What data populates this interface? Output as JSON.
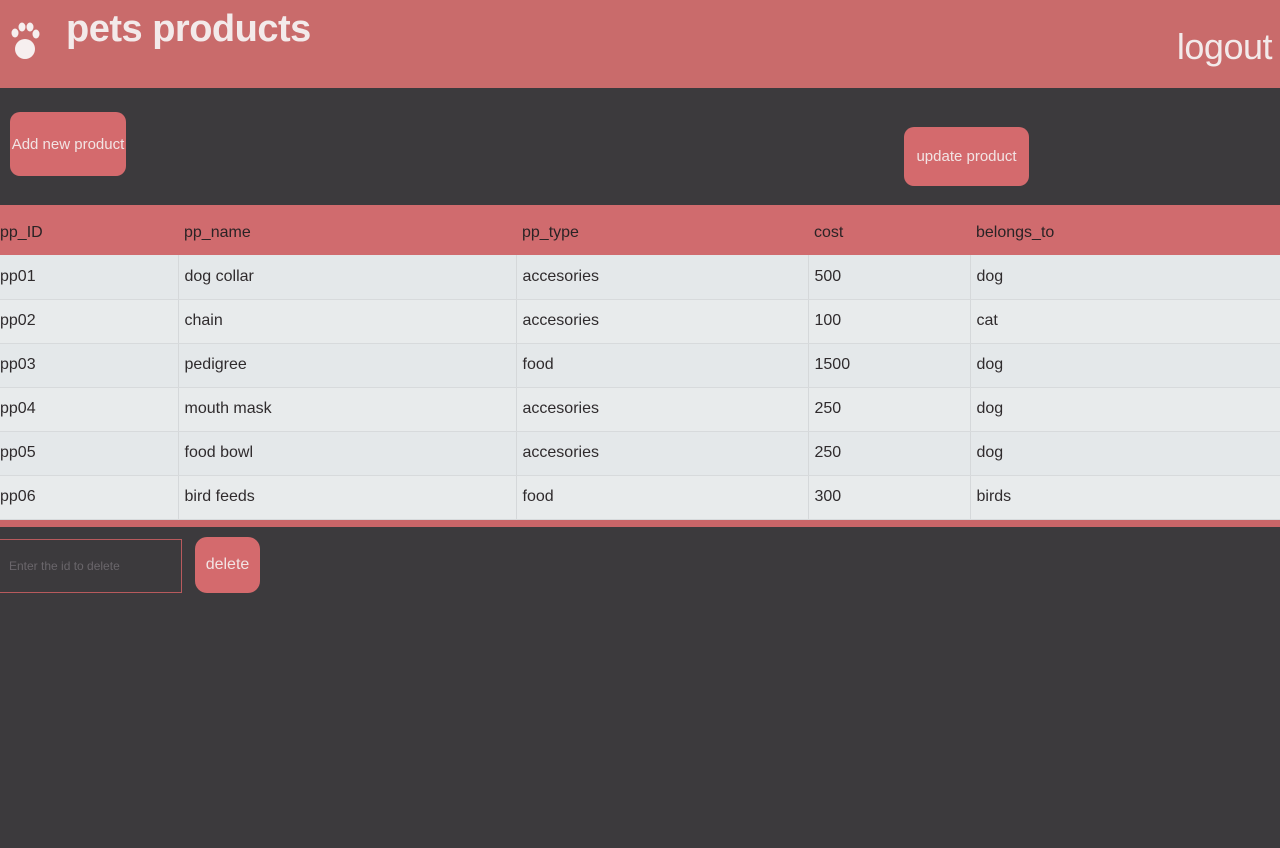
{
  "header": {
    "title": "pets products",
    "logout_label": "logout",
    "logo_icon": "paw-icon"
  },
  "toolbar": {
    "add_label": "Add new product",
    "update_label": "update product"
  },
  "table": {
    "columns": [
      "pp_ID",
      "pp_name",
      "pp_type",
      "cost",
      "belongs_to"
    ],
    "rows": [
      [
        "pp01",
        "dog collar",
        "accesories",
        "500",
        "dog"
      ],
      [
        "pp02",
        "chain",
        "accesories",
        "100",
        "cat"
      ],
      [
        "pp03",
        "pedigree",
        "food",
        "1500",
        "dog"
      ],
      [
        "pp04",
        "mouth mask",
        "accesories",
        "250",
        "dog"
      ],
      [
        "pp05",
        "food bowl",
        "accesories",
        "250",
        "dog"
      ],
      [
        "pp06",
        "bird feeds",
        "food",
        "300",
        "birds"
      ]
    ]
  },
  "delete_form": {
    "placeholder": "Enter the id to delete",
    "delete_label": "delete"
  },
  "colors": {
    "accent": "#c96b6b",
    "background": "#3c3a3d",
    "table_body": "#e4e8ea"
  }
}
